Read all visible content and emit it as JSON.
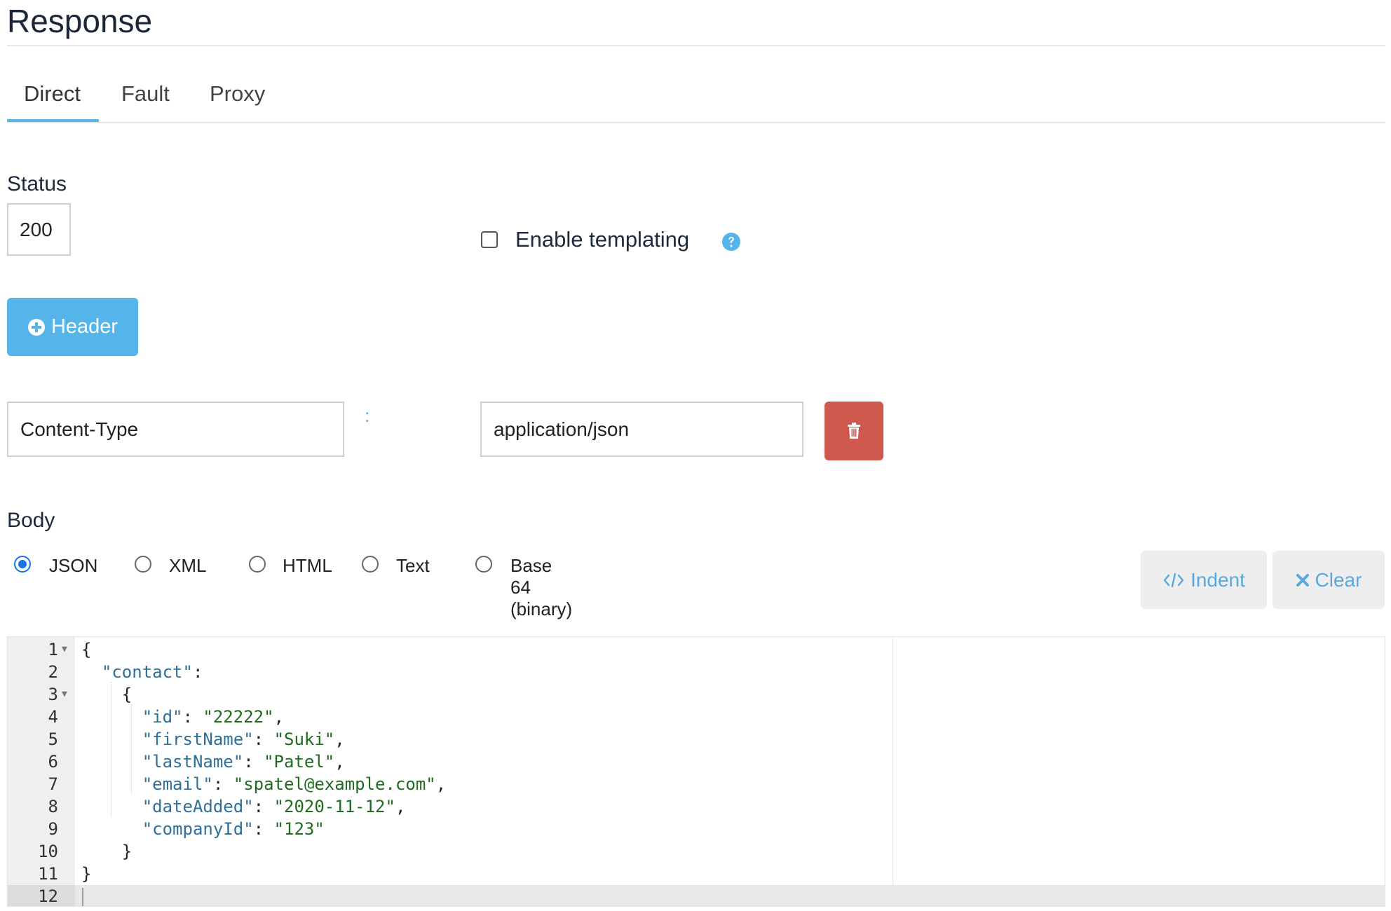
{
  "page": {
    "title": "Response"
  },
  "tabs": [
    "Direct",
    "Fault",
    "Proxy"
  ],
  "status": {
    "label": "Status",
    "value": "200"
  },
  "templating": {
    "label": "Enable templating",
    "checked": false,
    "help_icon": "question-circle-icon"
  },
  "header_button": {
    "label": "Header",
    "icon": "plus-circle-icon"
  },
  "header_row": {
    "name": "Content-Type",
    "separator": ":",
    "value": "application/json",
    "delete_icon": "trash-icon"
  },
  "body": {
    "label": "Body",
    "formats": [
      "JSON",
      "XML",
      "HTML",
      "Text",
      "Base 64 (binary)"
    ],
    "selected": "JSON",
    "indent_label": "Indent",
    "clear_label": "Clear"
  },
  "editor": {
    "line_numbers": [
      "1",
      "2",
      "3",
      "4",
      "5",
      "6",
      "7",
      "8",
      "9",
      "10",
      "11",
      "12"
    ],
    "lines": [
      "{",
      "  \"contact\":",
      "    {",
      "      \"id\": \"22222\",",
      "      \"firstName\": \"Suki\",",
      "      \"lastName\": \"Patel\",",
      "      \"email\": \"spatel@example.com\",",
      "      \"dateAdded\": \"2020-11-12\",",
      "      \"companyId\": \"123\"",
      "    }",
      "}",
      ""
    ]
  },
  "colors": {
    "accent": "#55b4ea",
    "danger": "#d0594f",
    "json_key": "#2f6f98",
    "json_string": "#1f6b1f"
  }
}
